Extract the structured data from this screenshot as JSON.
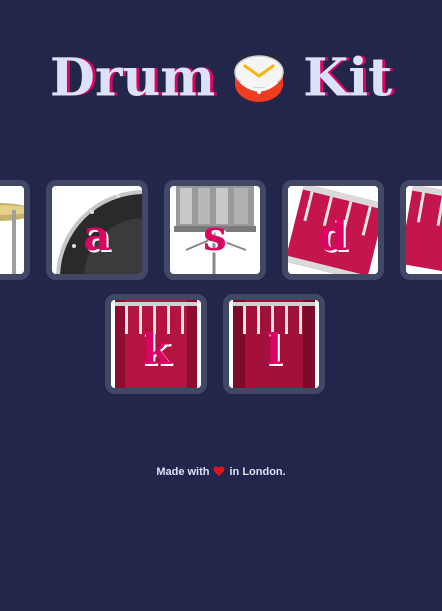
{
  "header": {
    "title_left": "Drum",
    "title_icon": "drum-emoji-icon",
    "title_right": "Kit"
  },
  "drums": [
    {
      "key": "",
      "kind": "crash-cymbal"
    },
    {
      "key": "a",
      "kind": "bass-drum"
    },
    {
      "key": "s",
      "kind": "snare-drum"
    },
    {
      "key": "d",
      "kind": "tom-1"
    },
    {
      "key": "",
      "kind": "tom-2"
    },
    {
      "key": "k",
      "kind": "tom-3"
    },
    {
      "key": "l",
      "kind": "tom-4"
    }
  ],
  "footer": {
    "prefix": "Made with",
    "icon": "heart-icon",
    "suffix": "in London."
  },
  "colors": {
    "background": "#22264b",
    "accent": "#da0463",
    "title": "#dbe2f7",
    "tile_border": "#404866",
    "drum_red": "#c4164c"
  }
}
